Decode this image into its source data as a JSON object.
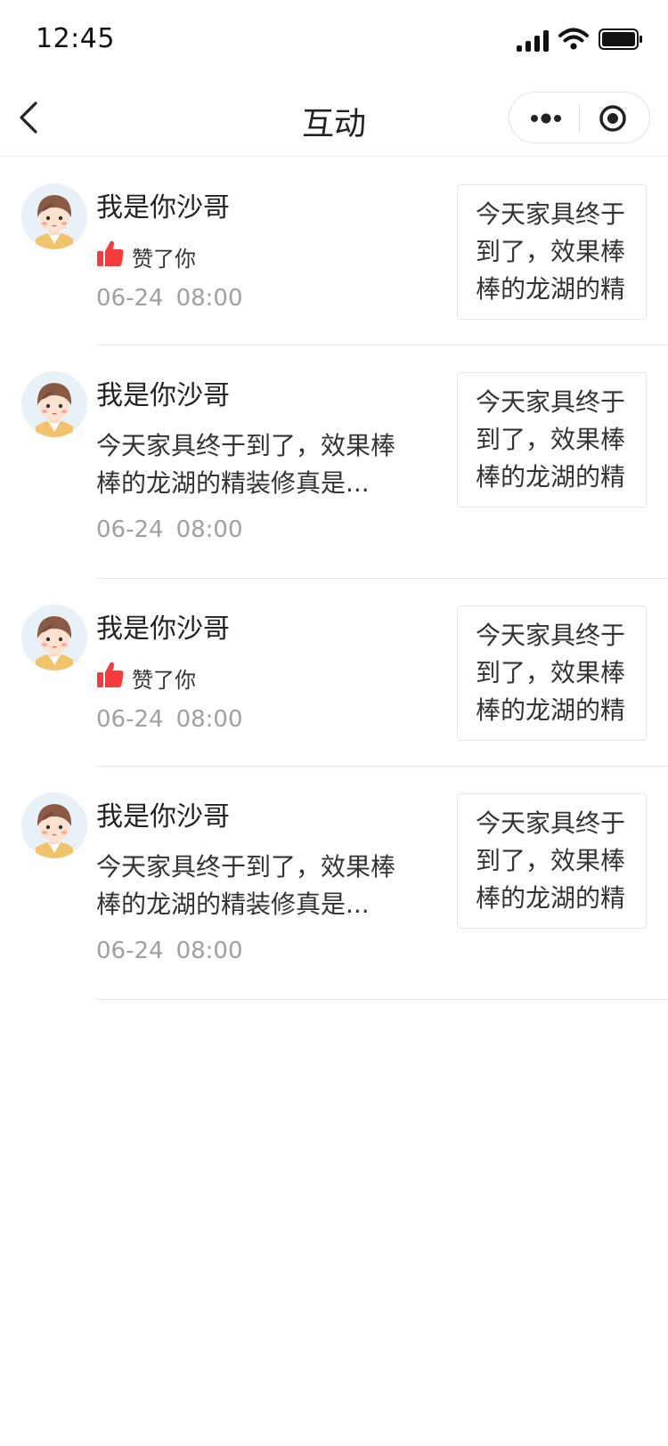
{
  "status_bar": {
    "time": "12:45"
  },
  "nav": {
    "title": "互动"
  },
  "items": [
    {
      "type": "like",
      "name": "我是你沙哥",
      "action": "赞了你",
      "date": "06-24",
      "time": "08:00",
      "post_excerpt": "今天家具终于到了，效果棒棒的龙湖的精"
    },
    {
      "type": "comment",
      "name": "我是你沙哥",
      "comment": "今天家具终于到了，效果棒棒的龙湖的精装修真是...",
      "date": "06-24",
      "time": "08:00",
      "post_excerpt": "今天家具终于到了，效果棒棒的龙湖的精"
    },
    {
      "type": "like",
      "name": "我是你沙哥",
      "action": "赞了你",
      "date": "06-24",
      "time": "08:00",
      "post_excerpt": "今天家具终于到了，效果棒棒的龙湖的精"
    },
    {
      "type": "comment",
      "name": "我是你沙哥",
      "comment": "今天家具终于到了，效果棒棒的龙湖的精装修真是...",
      "date": "06-24",
      "time": "08:00",
      "post_excerpt": "今天家具终于到了，效果棒棒的龙湖的精"
    }
  ],
  "colors": {
    "like": "#f53b3b",
    "muted": "#a0a0a0",
    "text": "#222222"
  },
  "icons": [
    "signal-icon",
    "wifi-icon",
    "battery-icon",
    "back-icon",
    "more-icon",
    "close-target-icon",
    "thumbs-up-icon",
    "avatar"
  ]
}
